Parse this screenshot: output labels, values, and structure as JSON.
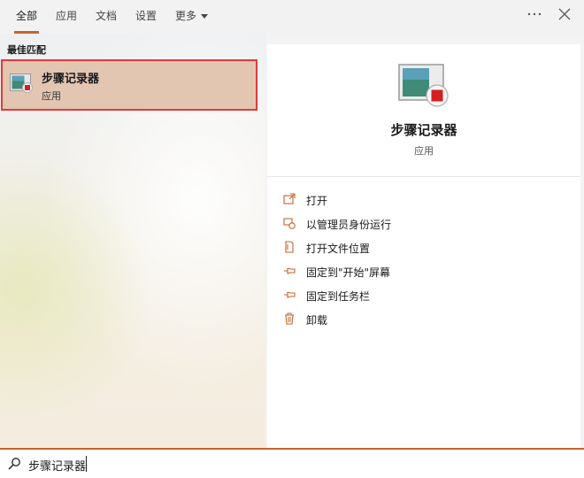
{
  "tabs": [
    {
      "label": "全部"
    },
    {
      "label": "应用"
    },
    {
      "label": "文档"
    },
    {
      "label": "设置"
    },
    {
      "label": "更多"
    }
  ],
  "section_title": "最佳匹配",
  "best_match": {
    "name": "步骤记录器",
    "type": "应用"
  },
  "detail": {
    "name": "步骤记录器",
    "type": "应用",
    "actions": [
      {
        "label": "打开",
        "icon": "open-icon"
      },
      {
        "label": "以管理员身份运行",
        "icon": "admin-shield-icon"
      },
      {
        "label": "打开文件位置",
        "icon": "file-location-icon"
      },
      {
        "label": "固定到\"开始\"屏幕",
        "icon": "pin-icon"
      },
      {
        "label": "固定到任务栏",
        "icon": "pin-icon"
      },
      {
        "label": "卸载",
        "icon": "trash-icon"
      }
    ]
  },
  "search": {
    "value": "步骤记录器"
  },
  "colors": {
    "accent": "#c8642a",
    "highlight_border": "#e23a3a",
    "selected_bg": "#e2c6b2"
  }
}
